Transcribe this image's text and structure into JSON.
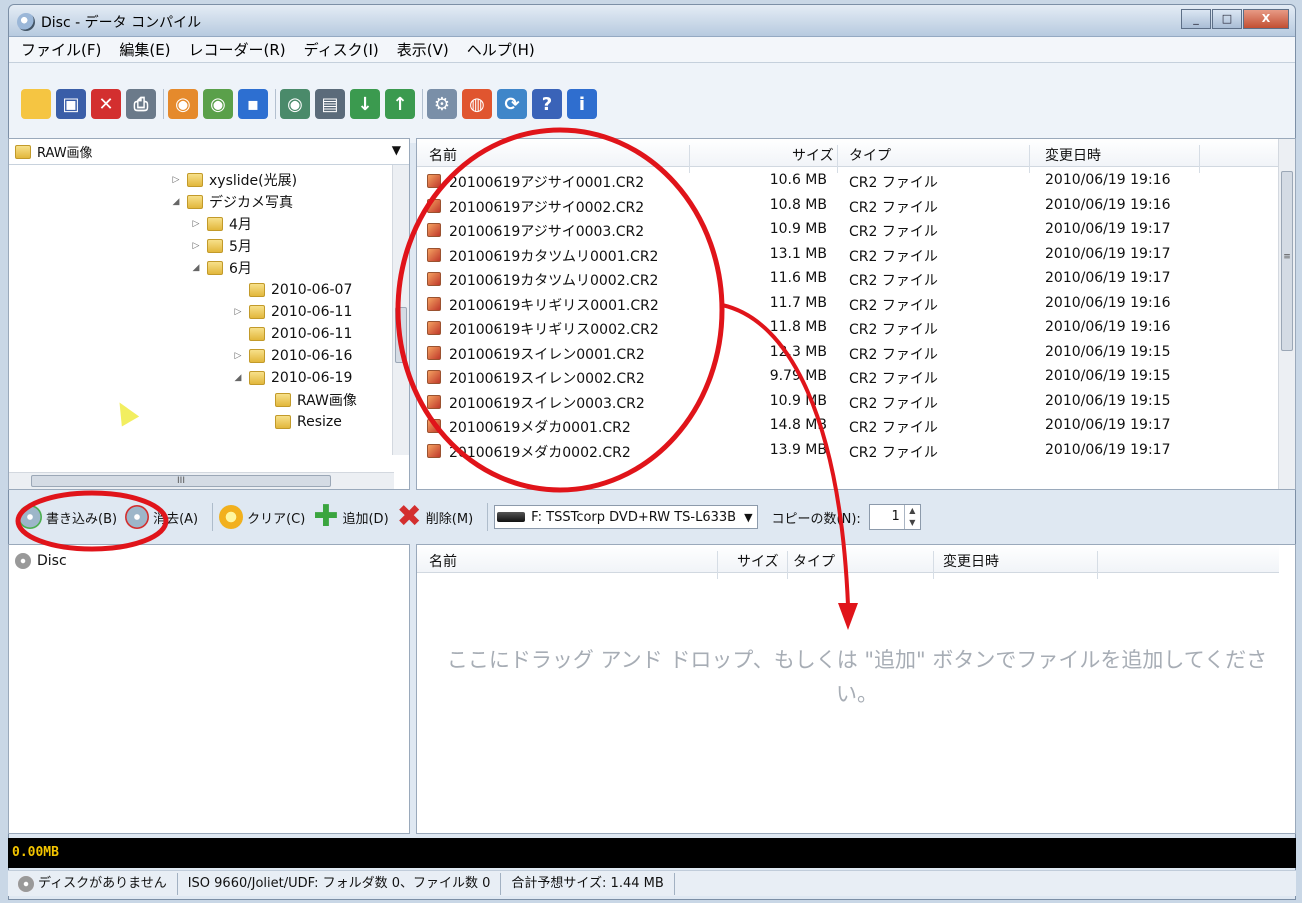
{
  "window": {
    "title": "Disc - データ コンパイル",
    "buttons": [
      "_",
      "□",
      "X"
    ]
  },
  "menu": [
    "ファイル(F)",
    "編集(E)",
    "レコーダー(R)",
    "ディスク(I)",
    "表示(V)",
    "ヘルプ(H)"
  ],
  "toolbar": {
    "icons": [
      {
        "name": "new-icon",
        "color": "#f5c542",
        "glyph": ""
      },
      {
        "name": "save-icon",
        "color": "#3a5ea8",
        "glyph": "▣"
      },
      {
        "name": "delete-icon",
        "color": "#d32f2f",
        "glyph": "✕"
      },
      {
        "name": "print-icon",
        "color": "#6b7a8a",
        "glyph": "⎙"
      },
      {
        "name": "sep"
      },
      {
        "name": "burn-disc-icon",
        "color": "#e58a2c",
        "glyph": "◉"
      },
      {
        "name": "copy-disc-icon",
        "color": "#5aa04a",
        "glyph": "◉"
      },
      {
        "name": "blue-disc-icon",
        "color": "#2d6fd1",
        "glyph": "▪"
      },
      {
        "name": "sep"
      },
      {
        "name": "disc-info-icon",
        "color": "#4a8a6a",
        "glyph": "◉"
      },
      {
        "name": "drive-icon",
        "color": "#5b6b7a",
        "glyph": "▤"
      },
      {
        "name": "import-icon",
        "color": "#3b9a4f",
        "glyph": "↓"
      },
      {
        "name": "export-icon",
        "color": "#3b9a4f",
        "glyph": "↑"
      },
      {
        "name": "sep"
      },
      {
        "name": "gear-icon",
        "color": "#7a8fa8",
        "glyph": "⚙"
      },
      {
        "name": "globe-icon",
        "color": "#e0552f",
        "glyph": "◍"
      },
      {
        "name": "update-icon",
        "color": "#3f86c9",
        "glyph": "⟳"
      },
      {
        "name": "help-icon",
        "color": "#3a63b8",
        "glyph": "?"
      },
      {
        "name": "info-icon",
        "color": "#2f6ecf",
        "glyph": "i"
      }
    ]
  },
  "folder_combo": {
    "value": "RAW画像"
  },
  "tree": [
    {
      "label": "xyslide(光展)",
      "indent": 160,
      "toggle": "▷"
    },
    {
      "label": "デジカメ写真",
      "indent": 160,
      "toggle": "◢"
    },
    {
      "label": "4月",
      "indent": 180,
      "toggle": "▷"
    },
    {
      "label": "5月",
      "indent": 180,
      "toggle": "▷"
    },
    {
      "label": "6月",
      "indent": 180,
      "toggle": "◢"
    },
    {
      "label": "2010-06-07",
      "indent": 222,
      "toggle": ""
    },
    {
      "label": "2010-06-11",
      "indent": 222,
      "toggle": "▷"
    },
    {
      "label": "2010-06-11",
      "indent": 222,
      "toggle": ""
    },
    {
      "label": "2010-06-16",
      "indent": 222,
      "toggle": "▷"
    },
    {
      "label": "2010-06-19",
      "indent": 222,
      "toggle": "◢"
    },
    {
      "label": "RAW画像",
      "indent": 248,
      "toggle": ""
    },
    {
      "label": "Resize",
      "indent": 248,
      "toggle": ""
    }
  ],
  "tree_hscroll_label": "III",
  "file_list": {
    "columns": [
      "名前",
      "サイズ",
      "タイプ",
      "変更日時"
    ],
    "rows": [
      {
        "name": "20100619アジサイ0001.CR2",
        "size": "10.6 MB",
        "type": "CR2 ファイル",
        "date": "2010/06/19 19:16"
      },
      {
        "name": "20100619アジサイ0002.CR2",
        "size": "10.8 MB",
        "type": "CR2 ファイル",
        "date": "2010/06/19 19:16"
      },
      {
        "name": "20100619アジサイ0003.CR2",
        "size": "10.9 MB",
        "type": "CR2 ファイル",
        "date": "2010/06/19 19:17"
      },
      {
        "name": "20100619カタツムリ0001.CR2",
        "size": "13.1 MB",
        "type": "CR2 ファイル",
        "date": "2010/06/19 19:17"
      },
      {
        "name": "20100619カタツムリ0002.CR2",
        "size": "11.6 MB",
        "type": "CR2 ファイル",
        "date": "2010/06/19 19:17"
      },
      {
        "name": "20100619キリギリス0001.CR2",
        "size": "11.7 MB",
        "type": "CR2 ファイル",
        "date": "2010/06/19 19:16"
      },
      {
        "name": "20100619キリギリス0002.CR2",
        "size": "11.8 MB",
        "type": "CR2 ファイル",
        "date": "2010/06/19 19:16"
      },
      {
        "name": "20100619スイレン0001.CR2",
        "size": "12.3 MB",
        "type": "CR2 ファイル",
        "date": "2010/06/19 19:15"
      },
      {
        "name": "20100619スイレン0002.CR2",
        "size": "9.79 MB",
        "type": "CR2 ファイル",
        "date": "2010/06/19 19:15"
      },
      {
        "name": "20100619スイレン0003.CR2",
        "size": "10.9 MB",
        "type": "CR2 ファイル",
        "date": "2010/06/19 19:15"
      },
      {
        "name": "20100619メダカ0001.CR2",
        "size": "14.8 MB",
        "type": "CR2 ファイル",
        "date": "2010/06/19 19:17"
      },
      {
        "name": "20100619メダカ0002.CR2",
        "size": "13.9 MB",
        "type": "CR2 ファイル",
        "date": "2010/06/19 19:17"
      }
    ]
  },
  "actions": {
    "burn": "書き込み(B)",
    "erase": "消去(A)",
    "clear": "クリア(C)",
    "add": "追加(D)",
    "remove": "削除(M)",
    "drive": "F: TSSTcorp DVD+RW TS-L633B",
    "copies_label": "コピーの数(N):",
    "copies_value": "1"
  },
  "disc_tree": {
    "root": "Disc"
  },
  "compile_list": {
    "columns": [
      "名前",
      "サイズ",
      "タイプ",
      "変更日時"
    ],
    "hint": "ここにドラッグ アンド ドロップ、もしくは \"追加\" ボタンでファイルを追加してください。"
  },
  "progress_text": "0.00MB",
  "status": {
    "disc": "ディスクがありません",
    "fs": "ISO 9660/Joliet/UDF: フォルダ数 0、ファイル数 0",
    "total": "合計予想サイズ: 1.44 MB"
  },
  "annotation_color": "#e0141a"
}
